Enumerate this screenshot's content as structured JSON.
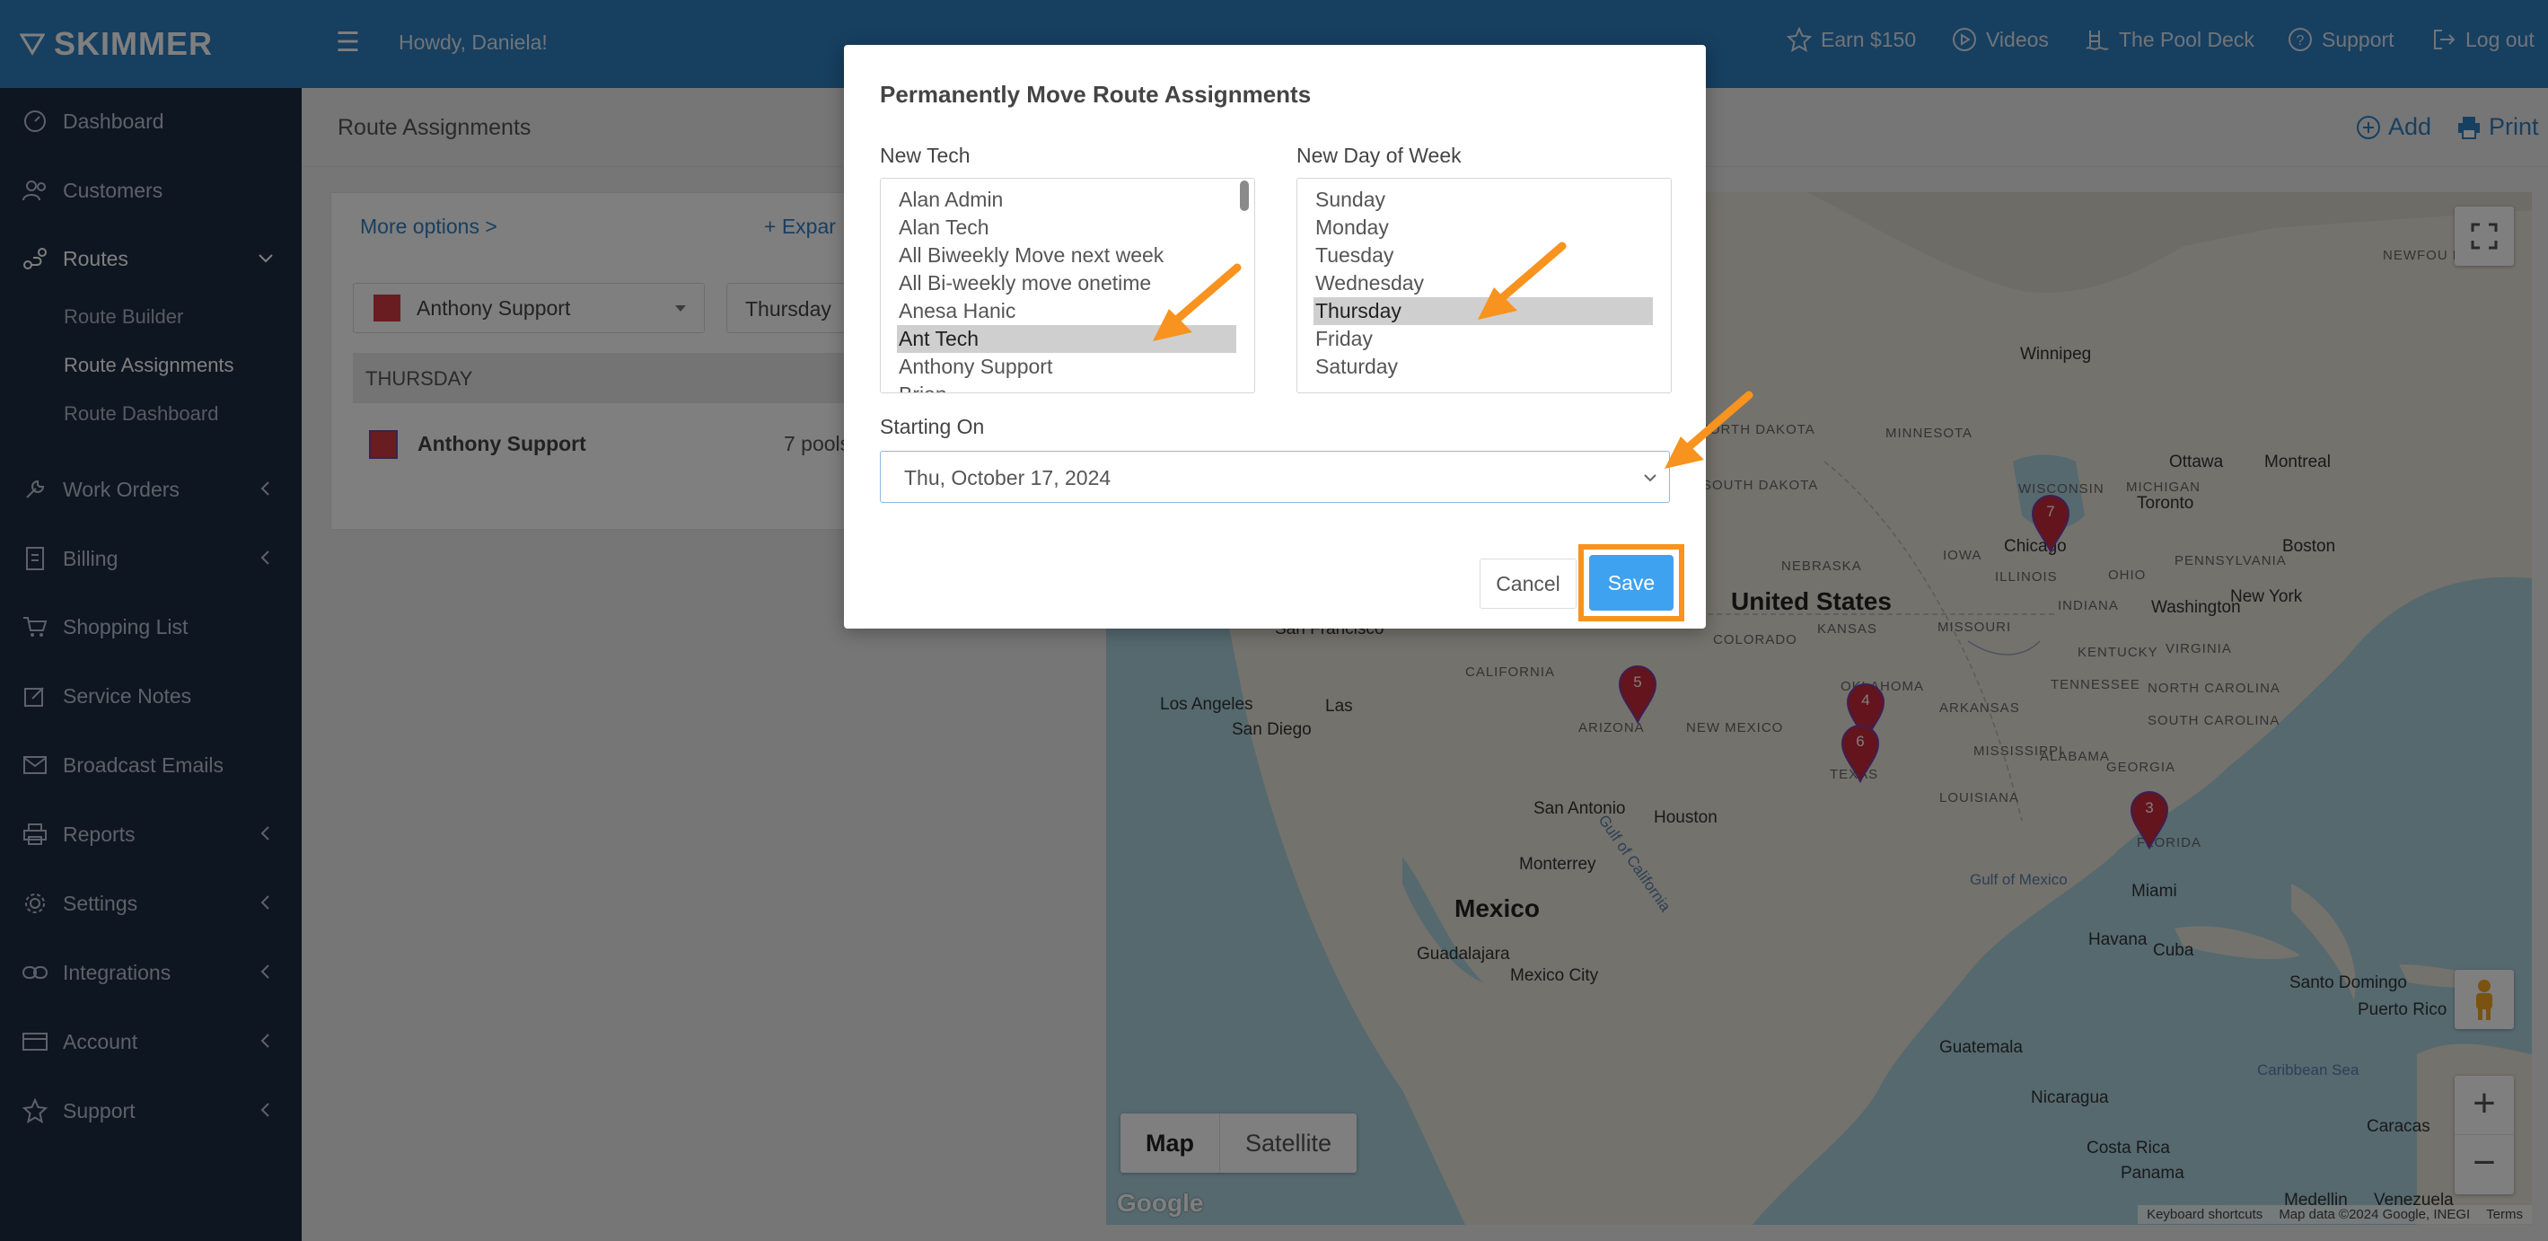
{
  "brand": {
    "name": "SKIMMER"
  },
  "topbar": {
    "greeting": "Howdy, Daniela!",
    "links": [
      "Earn $150",
      "Videos",
      "The Pool Deck",
      "Support",
      "Log out"
    ]
  },
  "sidebar": {
    "items": [
      {
        "label": "Dashboard"
      },
      {
        "label": "Customers"
      },
      {
        "label": "Routes"
      },
      {
        "label": "Work Orders"
      },
      {
        "label": "Billing"
      },
      {
        "label": "Shopping List"
      },
      {
        "label": "Service Notes"
      },
      {
        "label": "Broadcast Emails"
      },
      {
        "label": "Reports"
      },
      {
        "label": "Settings"
      },
      {
        "label": "Integrations"
      },
      {
        "label": "Account"
      },
      {
        "label": "Support"
      }
    ],
    "routes_sub": [
      "Route Builder",
      "Route Assignments",
      "Route Dashboard"
    ]
  },
  "page": {
    "title": "Route Assignments",
    "add_label": "Add",
    "print_label": "Print"
  },
  "panel": {
    "more_options": "More options >",
    "expand": "Expar",
    "tech_select_value": "Anthony Support",
    "day_select_value": "Thursday",
    "day_header": "THURSDAY",
    "row": {
      "tech": "Anthony Support",
      "pools": "7 pools"
    }
  },
  "modal": {
    "title": "Permanently Move Route Assignments",
    "new_tech_label": "New Tech",
    "tech_options": [
      "Alan Admin",
      "Alan Tech",
      "All Biweekly Move next week",
      "All Bi-weekly move onetime",
      "Anesa Hanic",
      "Ant Tech",
      "Anthony Support",
      "Brian"
    ],
    "selected_tech": "Ant Tech",
    "new_day_label": "New Day of Week",
    "day_options": [
      "Sunday",
      "Monday",
      "Tuesday",
      "Wednesday",
      "Thursday",
      "Friday",
      "Saturday"
    ],
    "selected_day": "Thursday",
    "starting_on_label": "Starting On",
    "starting_on_value": "Thu, October 17, 2024",
    "cancel_label": "Cancel",
    "save_label": "Save"
  },
  "map": {
    "map_type": [
      "Map",
      "Satellite"
    ],
    "labels": {
      "us": "United States",
      "mexico": "Mexico",
      "cuba": "Cuba",
      "winnipeg": "Winnipeg",
      "ottawa": "Ottawa",
      "montreal": "Montreal",
      "toronto": "Toronto",
      "boston": "Boston",
      "new_york": "New York",
      "washington": "Washington",
      "chicago": "Chicago",
      "san_francisco": "San Francisco",
      "los_angeles": "Los Angeles",
      "san_diego": "San Diego",
      "las_vegas": "Las",
      "san_antonio": "San Antonio",
      "houston": "Houston",
      "miami": "Miami",
      "havana": "Havana",
      "monterrey": "Monterrey",
      "guadalajara": "Guadalajara",
      "mexico_city": "Mexico City",
      "guatemala": "Guatemala",
      "nicaragua": "Nicaragua",
      "costa_rica": "Costa Rica",
      "panama": "Panama",
      "caracas": "Caracas",
      "medellin": "Medellin",
      "venezuela": "Venezuela",
      "puerto_rico": "Puerto Rico",
      "santo_domingo": "Santo Domingo",
      "newfoundland": "NEWFOU LAND",
      "wisconsin": "WISCONSIN",
      "iowa": "IOWA",
      "illinois": "ILLINOIS",
      "indiana": "INDIANA",
      "ohio": "OHIO",
      "nebraska": "NEBRASKA",
      "kansas": "KANSAS",
      "missouri": "MISSOURI",
      "kentucky": "KENTUCKY",
      "virginia": "VIRGINIA",
      "tennessee": "TENNESSEE",
      "north_carolina": "NORTH CAROLINA",
      "south_carolina": "SOUTH CAROLINA",
      "georgia": "GEORGIA",
      "alabama": "ALABAMA",
      "mississippi": "MISSISSIPPI",
      "arkansas": "ARKANSAS",
      "louisiana": "LOUISIANA",
      "florida": "FLORIDA",
      "texas": "TEXAS",
      "oklahoma": "OKLAHOMA",
      "new_mexico": "NEW MEXICO",
      "arizona": "ARIZONA",
      "california": "CALIFORNIA",
      "colorado": "COLORADO",
      "north_dakota": "NORTH DAKOTA",
      "south_dakota": "SOUTH DAKOTA",
      "minnesota": "MINNESOTA",
      "michigan": "MICHIGAN",
      "pennsylvania": "PENNSYLVANIA",
      "gulf_mexico": "Gulf of Mexico",
      "gulf_california": "Gulf of California",
      "caribbean": "Caribbean Sea"
    },
    "pins": [
      "7",
      "5",
      "4",
      "6",
      "3"
    ],
    "attrib": [
      "Keyboard shortcuts",
      "Map data ©2024 Google, INEGI",
      "Terms"
    ],
    "google": "Google"
  },
  "colors": {
    "accent": "#2f7fc1",
    "sidebar": "#1d2d43",
    "highlight": "#f7931e",
    "save": "#3fa2f0",
    "pin": "#c8283a"
  }
}
